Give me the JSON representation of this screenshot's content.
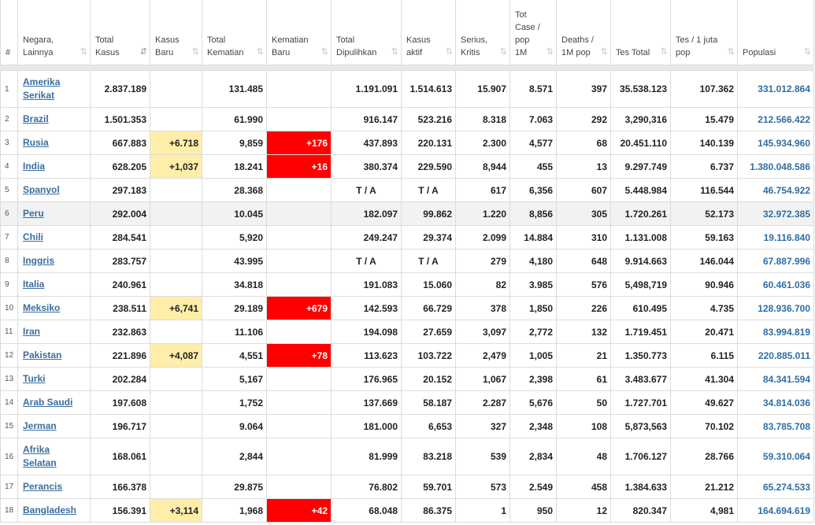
{
  "table": {
    "headers": [
      {
        "id": "num",
        "label": "#",
        "sortable": false
      },
      {
        "id": "country",
        "label": "Negara, Lainnya",
        "sortable": true
      },
      {
        "id": "total_cases",
        "label": "Total Kasus",
        "sortable": true,
        "active": true
      },
      {
        "id": "new_cases",
        "label": "Kasus Baru",
        "sortable": true
      },
      {
        "id": "total_deaths",
        "label": "Total Kematian",
        "sortable": true
      },
      {
        "id": "new_deaths",
        "label": "Kematian Baru",
        "sortable": true
      },
      {
        "id": "total_recovered",
        "label": "Total Dipulihkan",
        "sortable": true
      },
      {
        "id": "active_cases",
        "label": "Kasus aktif",
        "sortable": true
      },
      {
        "id": "serious",
        "label": "Serius, Kritis",
        "sortable": true
      },
      {
        "id": "cases_per_1m",
        "label": "Tot Case / pop 1M",
        "sortable": true
      },
      {
        "id": "deaths_per_1m",
        "label": "Deaths / 1M pop",
        "sortable": true
      },
      {
        "id": "total_tests",
        "label": "Tes Total",
        "sortable": true
      },
      {
        "id": "tests_per_1m",
        "label": "Tes / 1 juta pop",
        "sortable": true
      },
      {
        "id": "population",
        "label": "Populasi",
        "sortable": true
      }
    ],
    "sort_icon": "⇅",
    "sort_icon_active": "⇵",
    "highlight_colors": {
      "new_cases": "#ffeeaa",
      "new_deaths": "#ff0000"
    },
    "rows": [
      {
        "num": "1",
        "country": "Amerika Serikat",
        "total_cases": "2.837.189",
        "new_cases": "",
        "total_deaths": "131.485",
        "new_deaths": "",
        "total_recovered": "1.191.091",
        "active_cases": "1.514.613",
        "serious": "15.907",
        "cases_per_1m": "8.571",
        "deaths_per_1m": "397",
        "total_tests": "35.538.123",
        "tests_per_1m": "107.362",
        "population": "331.012.864"
      },
      {
        "num": "2",
        "country": "Brazil",
        "total_cases": "1.501.353",
        "new_cases": "",
        "total_deaths": "61.990",
        "new_deaths": "",
        "total_recovered": "916.147",
        "active_cases": "523.216",
        "serious": "8.318",
        "cases_per_1m": "7.063",
        "deaths_per_1m": "292",
        "total_tests": "3,290,316",
        "tests_per_1m": "15.479",
        "population": "212.566.422"
      },
      {
        "num": "3",
        "country": "Rusia",
        "total_cases": "667.883",
        "new_cases": "+6.718",
        "total_deaths": "9,859",
        "new_deaths": "+176",
        "total_recovered": "437.893",
        "active_cases": "220.131",
        "serious": "2.300",
        "cases_per_1m": "4,577",
        "deaths_per_1m": "68",
        "total_tests": "20.451.110",
        "tests_per_1m": "140.139",
        "population": "145.934.960"
      },
      {
        "num": "4",
        "country": "India",
        "total_cases": "628.205",
        "new_cases": "+1,037",
        "total_deaths": "18.241",
        "new_deaths": "+16",
        "total_recovered": "380.374",
        "active_cases": "229.590",
        "serious": "8,944",
        "cases_per_1m": "455",
        "deaths_per_1m": "13",
        "total_tests": "9.297.749",
        "tests_per_1m": "6.737",
        "population": "1.380.048.586"
      },
      {
        "num": "5",
        "country": "Spanyol",
        "total_cases": "297.183",
        "new_cases": "",
        "total_deaths": "28.368",
        "new_deaths": "",
        "total_recovered": "T / A",
        "active_cases": "T / A",
        "serious": "617",
        "cases_per_1m": "6,356",
        "deaths_per_1m": "607",
        "total_tests": "5.448.984",
        "tests_per_1m": "116.544",
        "population": "46.754.922"
      },
      {
        "num": "6",
        "country": "Peru",
        "total_cases": "292.004",
        "new_cases": "",
        "total_deaths": "10.045",
        "new_deaths": "",
        "total_recovered": "182.097",
        "active_cases": "99.862",
        "serious": "1.220",
        "cases_per_1m": "8,856",
        "deaths_per_1m": "305",
        "total_tests": "1.720.261",
        "tests_per_1m": "52.173",
        "population": "32.972.385"
      },
      {
        "num": "7",
        "country": "Chili",
        "total_cases": "284.541",
        "new_cases": "",
        "total_deaths": "5,920",
        "new_deaths": "",
        "total_recovered": "249.247",
        "active_cases": "29.374",
        "serious": "2.099",
        "cases_per_1m": "14.884",
        "deaths_per_1m": "310",
        "total_tests": "1.131.008",
        "tests_per_1m": "59.163",
        "population": "19.116.840"
      },
      {
        "num": "8",
        "country": "Inggris",
        "total_cases": "283.757",
        "new_cases": "",
        "total_deaths": "43.995",
        "new_deaths": "",
        "total_recovered": "T / A",
        "active_cases": "T / A",
        "serious": "279",
        "cases_per_1m": "4,180",
        "deaths_per_1m": "648",
        "total_tests": "9.914.663",
        "tests_per_1m": "146.044",
        "population": "67.887.996"
      },
      {
        "num": "9",
        "country": "Italia",
        "total_cases": "240.961",
        "new_cases": "",
        "total_deaths": "34.818",
        "new_deaths": "",
        "total_recovered": "191.083",
        "active_cases": "15.060",
        "serious": "82",
        "cases_per_1m": "3.985",
        "deaths_per_1m": "576",
        "total_tests": "5,498,719",
        "tests_per_1m": "90.946",
        "population": "60.461.036"
      },
      {
        "num": "10",
        "country": "Meksiko",
        "total_cases": "238.511",
        "new_cases": "+6,741",
        "total_deaths": "29.189",
        "new_deaths": "+679",
        "total_recovered": "142.593",
        "active_cases": "66.729",
        "serious": "378",
        "cases_per_1m": "1,850",
        "deaths_per_1m": "226",
        "total_tests": "610.495",
        "tests_per_1m": "4.735",
        "population": "128.936.700"
      },
      {
        "num": "11",
        "country": "Iran",
        "total_cases": "232.863",
        "new_cases": "",
        "total_deaths": "11.106",
        "new_deaths": "",
        "total_recovered": "194.098",
        "active_cases": "27.659",
        "serious": "3,097",
        "cases_per_1m": "2,772",
        "deaths_per_1m": "132",
        "total_tests": "1.719.451",
        "tests_per_1m": "20.471",
        "population": "83.994.819"
      },
      {
        "num": "12",
        "country": "Pakistan",
        "total_cases": "221.896",
        "new_cases": "+4,087",
        "total_deaths": "4,551",
        "new_deaths": "+78",
        "total_recovered": "113.623",
        "active_cases": "103.722",
        "serious": "2,479",
        "cases_per_1m": "1,005",
        "deaths_per_1m": "21",
        "total_tests": "1.350.773",
        "tests_per_1m": "6.115",
        "population": "220.885.011"
      },
      {
        "num": "13",
        "country": "Turki",
        "total_cases": "202.284",
        "new_cases": "",
        "total_deaths": "5,167",
        "new_deaths": "",
        "total_recovered": "176.965",
        "active_cases": "20.152",
        "serious": "1,067",
        "cases_per_1m": "2,398",
        "deaths_per_1m": "61",
        "total_tests": "3.483.677",
        "tests_per_1m": "41.304",
        "population": "84.341.594"
      },
      {
        "num": "14",
        "country": "Arab Saudi",
        "total_cases": "197.608",
        "new_cases": "",
        "total_deaths": "1,752",
        "new_deaths": "",
        "total_recovered": "137.669",
        "active_cases": "58.187",
        "serious": "2.287",
        "cases_per_1m": "5,676",
        "deaths_per_1m": "50",
        "total_tests": "1.727.701",
        "tests_per_1m": "49.627",
        "population": "34.814.036"
      },
      {
        "num": "15",
        "country": "Jerman",
        "total_cases": "196.717",
        "new_cases": "",
        "total_deaths": "9.064",
        "new_deaths": "",
        "total_recovered": "181.000",
        "active_cases": "6,653",
        "serious": "327",
        "cases_per_1m": "2,348",
        "deaths_per_1m": "108",
        "total_tests": "5,873,563",
        "tests_per_1m": "70.102",
        "population": "83.785.708"
      },
      {
        "num": "16",
        "country": "Afrika Selatan",
        "total_cases": "168.061",
        "new_cases": "",
        "total_deaths": "2,844",
        "new_deaths": "",
        "total_recovered": "81.999",
        "active_cases": "83.218",
        "serious": "539",
        "cases_per_1m": "2,834",
        "deaths_per_1m": "48",
        "total_tests": "1.706.127",
        "tests_per_1m": "28.766",
        "population": "59.310.064"
      },
      {
        "num": "17",
        "country": "Perancis",
        "total_cases": "166.378",
        "new_cases": "",
        "total_deaths": "29.875",
        "new_deaths": "",
        "total_recovered": "76.802",
        "active_cases": "59.701",
        "serious": "573",
        "cases_per_1m": "2.549",
        "deaths_per_1m": "458",
        "total_tests": "1.384.633",
        "tests_per_1m": "21.212",
        "population": "65.274.533"
      },
      {
        "num": "18",
        "country": "Bangladesh",
        "total_cases": "156.391",
        "new_cases": "+3,114",
        "total_deaths": "1,968",
        "new_deaths": "+42",
        "total_recovered": "68.048",
        "active_cases": "86.375",
        "serious": "1",
        "cases_per_1m": "950",
        "deaths_per_1m": "12",
        "total_tests": "820.347",
        "tests_per_1m": "4,981",
        "population": "164.694.619"
      }
    ]
  }
}
